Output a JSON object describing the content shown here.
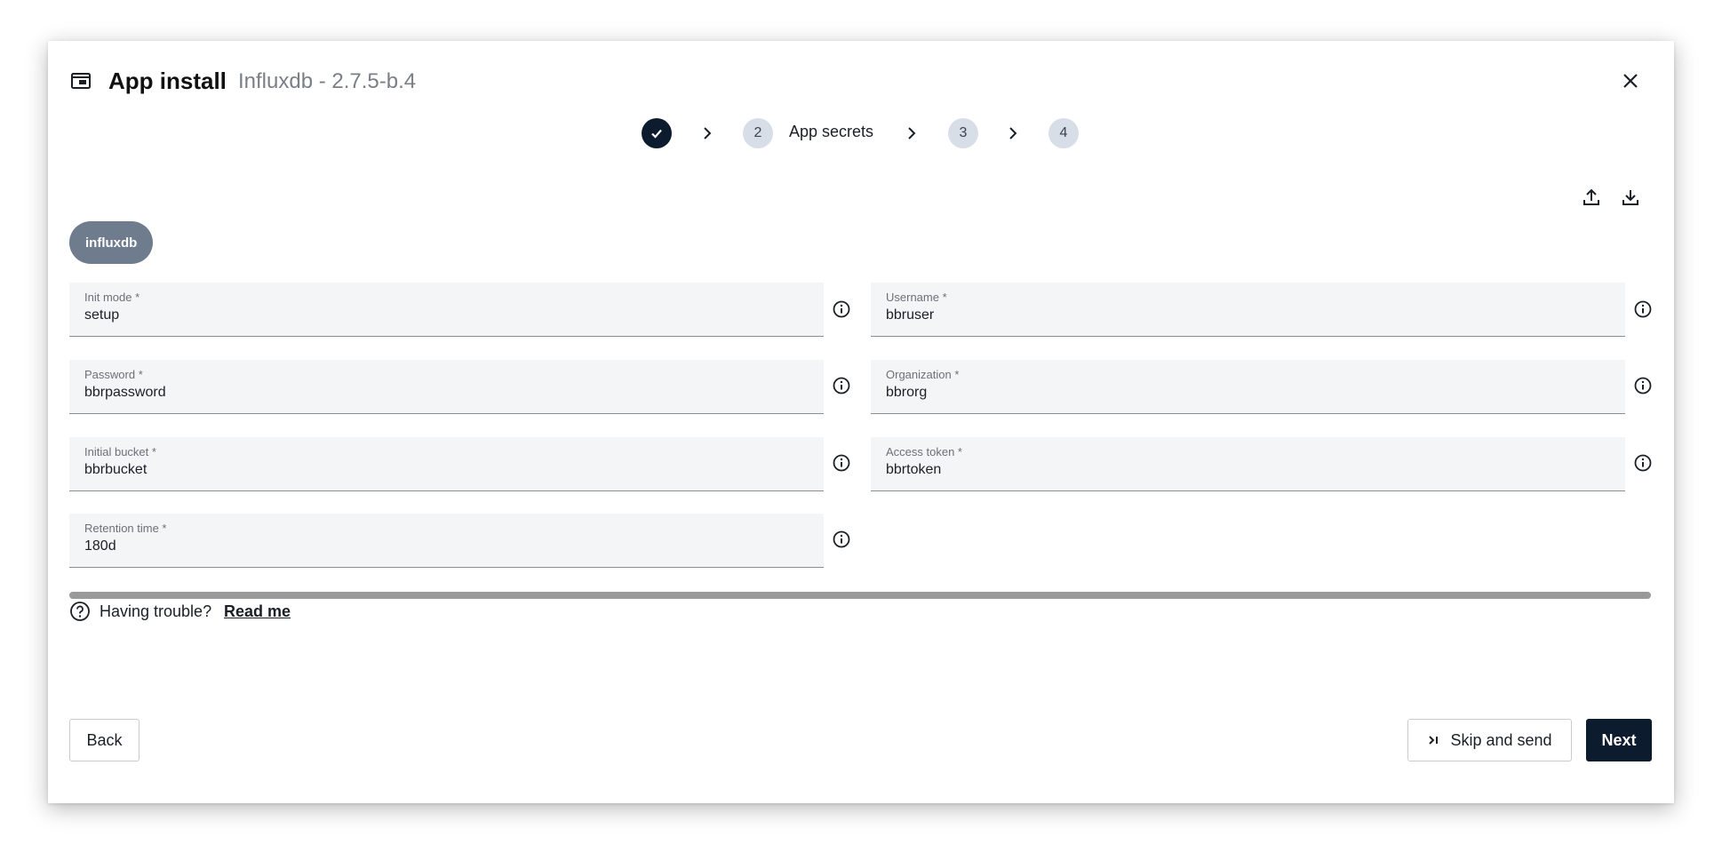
{
  "header": {
    "title": "App install",
    "subtitle": "Influxdb - 2.7.5-b.4"
  },
  "stepper": {
    "steps": [
      {
        "number": "",
        "label": "",
        "state": "done"
      },
      {
        "number": "2",
        "label": "App secrets",
        "state": "active"
      },
      {
        "number": "3",
        "label": "",
        "state": "pending"
      },
      {
        "number": "4",
        "label": "",
        "state": "pending"
      }
    ]
  },
  "chip": {
    "label": "influxdb"
  },
  "fields": {
    "init_mode": {
      "label": "Init mode *",
      "value": "setup"
    },
    "username": {
      "label": "Username *",
      "value": "bbruser"
    },
    "password": {
      "label": "Password *",
      "value": "bbrpassword"
    },
    "organization": {
      "label": "Organization *",
      "value": "bbrorg"
    },
    "initial_bucket": {
      "label": "Initial bucket *",
      "value": "bbrbucket"
    },
    "access_token": {
      "label": "Access token *",
      "value": "bbrtoken"
    },
    "retention_time": {
      "label": "Retention time *",
      "value": "180d"
    }
  },
  "help": {
    "text": "Having trouble?",
    "link": "Read me"
  },
  "footer": {
    "back_label": "Back",
    "skip_label": "Skip and send",
    "next_label": "Next"
  },
  "icons": {
    "app": "window-icon",
    "close": "close-icon",
    "upload": "upload-icon",
    "download": "download-icon",
    "info": "info-icon",
    "help": "help-circle-icon",
    "skip": "skip-to-end-icon"
  },
  "colors": {
    "primary": "#0d1b2e",
    "chip": "#6e7c8d",
    "step_pending": "#d8dee8",
    "field_bg": "#f4f5f7"
  }
}
